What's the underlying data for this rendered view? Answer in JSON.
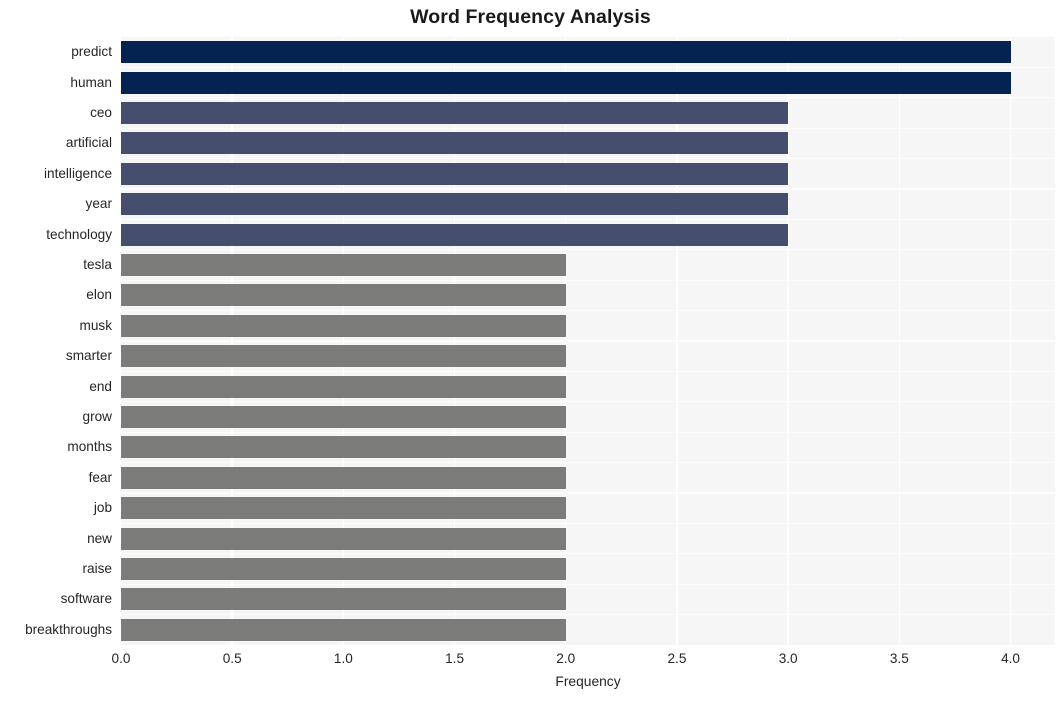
{
  "chart_data": {
    "type": "bar",
    "orientation": "horizontal",
    "title": "Word Frequency Analysis",
    "xlabel": "Frequency",
    "ylabel": "",
    "xlim": [
      0.0,
      4.2
    ],
    "xticks": [
      "0.0",
      "0.5",
      "1.0",
      "1.5",
      "2.0",
      "2.5",
      "3.0",
      "3.5",
      "4.0"
    ],
    "xtick_values": [
      0.0,
      0.5,
      1.0,
      1.5,
      2.0,
      2.5,
      3.0,
      3.5,
      4.0
    ],
    "categories": [
      "predict",
      "human",
      "ceo",
      "artificial",
      "intelligence",
      "year",
      "technology",
      "tesla",
      "elon",
      "musk",
      "smarter",
      "end",
      "grow",
      "months",
      "fear",
      "job",
      "new",
      "raise",
      "software",
      "breakthroughs"
    ],
    "values": [
      4,
      4,
      3,
      3,
      3,
      3,
      3,
      2,
      2,
      2,
      2,
      2,
      2,
      2,
      2,
      2,
      2,
      2,
      2,
      2
    ],
    "bar_colors": [
      "#042350",
      "#042350",
      "#454e6d",
      "#454e6d",
      "#454e6d",
      "#454e6d",
      "#454e6d",
      "#7b7b7a",
      "#7b7b7a",
      "#7b7b7a",
      "#7b7b7a",
      "#7b7b7a",
      "#7b7b7a",
      "#7b7b7a",
      "#7b7b7a",
      "#7b7b7a",
      "#7b7b7a",
      "#7b7b7a",
      "#7b7b7a",
      "#7b7b7a"
    ],
    "grid": true,
    "gridline_color": "#ffffff",
    "plot_background": "#f6f6f7",
    "figure_background": "#ffffff",
    "legend": null
  },
  "colors": {
    "navy": "#042350",
    "slate": "#454e6d",
    "gray": "#7b7b7a",
    "plot_bg": "#f6f6f7",
    "grid": "#ffffff",
    "text": "#262626"
  }
}
